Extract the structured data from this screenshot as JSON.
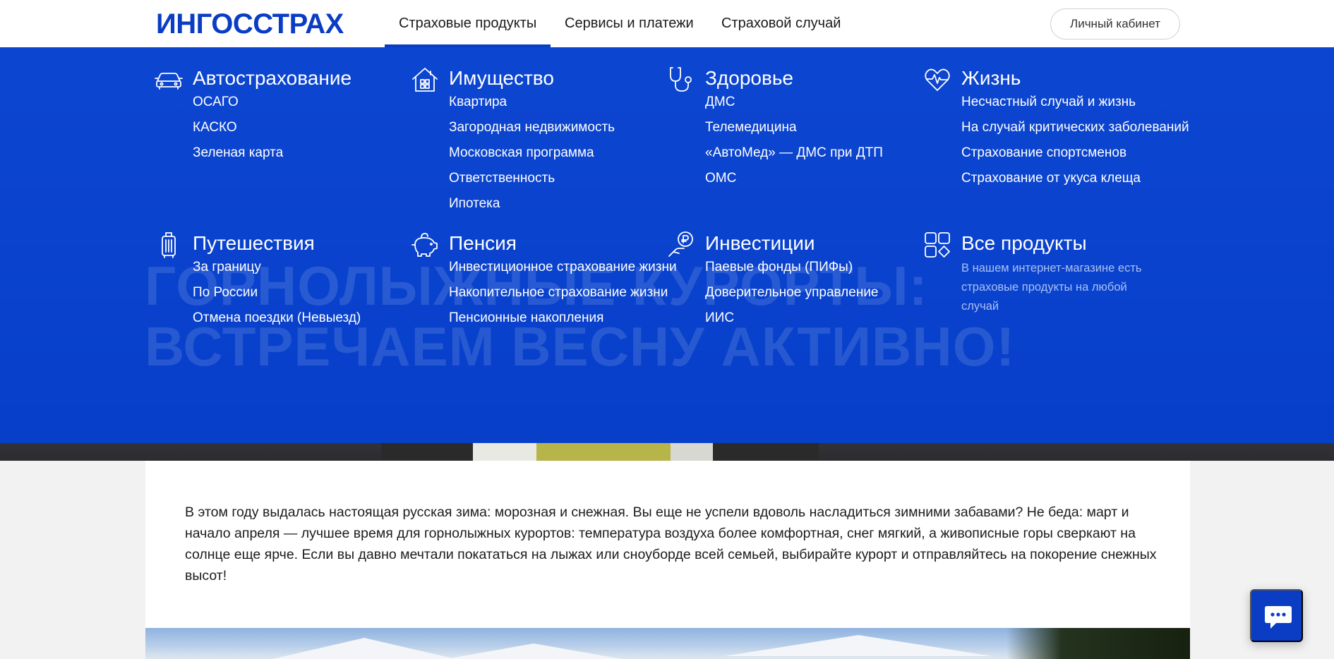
{
  "header": {
    "logo": "ИНГОССТРАХ",
    "nav": [
      {
        "label": "Страховые продукты",
        "active": true
      },
      {
        "label": "Сервисы и платежи",
        "active": false
      },
      {
        "label": "Страховой случай",
        "active": false
      }
    ],
    "cabinet_label": "Личный кабинет"
  },
  "hero": {
    "title_line1": "ГОРНОЛЫЖНЫЕ КУРОРТЫ:",
    "title_line2": "ВСТРЕЧАЕМ ВЕСНУ АКТИВНО!"
  },
  "menu": {
    "categories": [
      {
        "title": "Автострахование",
        "icon": "car-icon",
        "links": [
          "ОСАГО",
          "КАСКО",
          "Зеленая карта"
        ]
      },
      {
        "title": "Имущество",
        "icon": "house-icon",
        "links": [
          "Квартира",
          "Загородная недвижимость",
          "Московская программа",
          "Ответственность",
          "Ипотека"
        ]
      },
      {
        "title": "Здоровье",
        "icon": "stethoscope-icon",
        "links": [
          "ДМС",
          "Телемедицина",
          "«АвтоМед» — ДМС при ДТП",
          "ОМС"
        ]
      },
      {
        "title": "Жизнь",
        "icon": "heart-pulse-icon",
        "links": [
          "Несчастный случай и жизнь",
          "На случай критических заболеваний",
          "Страхование спортсменов",
          "Страхование от укуса клеща"
        ]
      },
      {
        "title": "Путешествия",
        "icon": "suitcase-icon",
        "links": [
          "За границу",
          "По России",
          "Отмена поездки (Невыезд)"
        ]
      },
      {
        "title": "Пенсия",
        "icon": "piggy-bank-icon",
        "links": [
          "Инвестиционное страхование жизни",
          "Накопительное страхование жизни",
          "Пенсионные накопления"
        ]
      },
      {
        "title": "Инвестиции",
        "icon": "ruble-hand-icon",
        "links": [
          "Паевые фонды (ПИФы)",
          "Доверительное управление",
          "ИИС"
        ]
      },
      {
        "title": "Все продукты",
        "icon": "grid-icon",
        "description": "В нашем интернет-магазине есть страховые продукты на любой случай"
      }
    ]
  },
  "article": {
    "text": "В этом году выдалась настоящая русская зима: морозная и снежная. Вы еще не успели вдоволь насладиться зимними забавами? Не беда: март и начало апреля — лучшее время для горнолыжных курортов: температура воздуха более комфортная, снег мягкий, а живописные горы сверкают на солнце еще ярче. Если вы давно мечтали покататься на лыжах или сноуборде всей семьей, выбирайте курорт и отправляйтесь на покорение снежных высот!"
  },
  "chat": {
    "icon": "chat-icon"
  },
  "colors": {
    "brand": "#0a3dc4",
    "menu_bg": "#0440d2",
    "menu_desc": "#a9c0f2"
  }
}
